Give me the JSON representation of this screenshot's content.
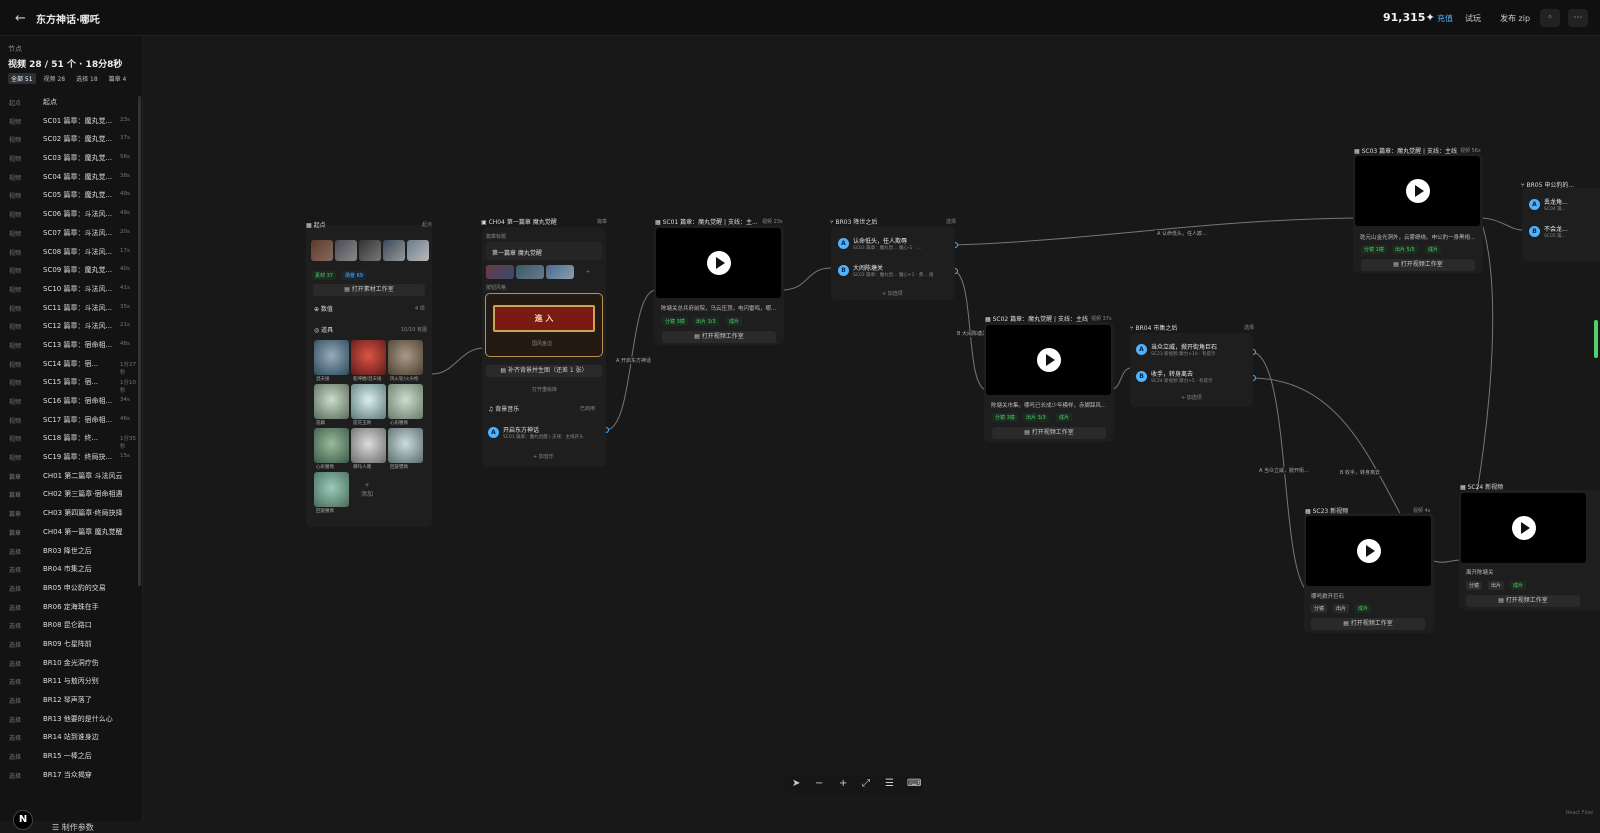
{
  "header": {
    "back_icon": "←",
    "title": "东方神话·哪吒",
    "credits": "91,315✦",
    "recharge": "充值",
    "trial": "试玩",
    "publish": "发布 zip",
    "btn1": "◦",
    "btn2": "⋯"
  },
  "sidebar": {
    "label": "节点",
    "count": "视频 28 / 51 个 · 18分8秒",
    "filters": [
      "全部 51",
      "视频 28",
      "选择 18",
      "篇章 4"
    ],
    "items": [
      {
        "type": "起点",
        "name": "起点",
        "dur": ""
      },
      {
        "type": "视频",
        "name": "SC01 篇章：魔丸觉...",
        "dur": "23s"
      },
      {
        "type": "视频",
        "name": "SC02 篇章：魔丸觉...",
        "dur": "37s"
      },
      {
        "type": "视频",
        "name": "SC03 篇章：魔丸觉...",
        "dur": "56s"
      },
      {
        "type": "视频",
        "name": "SC04 篇章：魔丸觉...",
        "dur": "38s"
      },
      {
        "type": "视频",
        "name": "SC05 篇章：魔丸觉...",
        "dur": "49s"
      },
      {
        "type": "视频",
        "name": "SC06 篇章：斗法风...",
        "dur": "49s"
      },
      {
        "type": "视频",
        "name": "SC07 篇章：斗法风...",
        "dur": "20s"
      },
      {
        "type": "视频",
        "name": "SC08 篇章：斗法风...",
        "dur": "17s"
      },
      {
        "type": "视频",
        "name": "SC09 篇章：魔丸觉...",
        "dur": "40s"
      },
      {
        "type": "视频",
        "name": "SC10 篇章：斗法风...",
        "dur": "41s"
      },
      {
        "type": "视频",
        "name": "SC11 篇章：斗法风...",
        "dur": "35s"
      },
      {
        "type": "视频",
        "name": "SC12 篇章：斗法风...",
        "dur": "21s"
      },
      {
        "type": "视频",
        "name": "SC13 篇章：宿命相...",
        "dur": "48s"
      },
      {
        "type": "视频",
        "name": "SC14 篇章：宿...",
        "dur": "1分27秒"
      },
      {
        "type": "视频",
        "name": "SC15 篇章：宿...",
        "dur": "1分10秒"
      },
      {
        "type": "视频",
        "name": "SC16 篇章：宿命相...",
        "dur": "34s"
      },
      {
        "type": "视频",
        "name": "SC17 篇章：宿命相...",
        "dur": "46s"
      },
      {
        "type": "视频",
        "name": "SC18 篇章：终...",
        "dur": "1分35秒"
      },
      {
        "type": "视频",
        "name": "SC19 篇章：终局抉...",
        "dur": "15s"
      },
      {
        "type": "篇章",
        "name": "CH01 第二篇章 斗法风云",
        "dur": ""
      },
      {
        "type": "篇章",
        "name": "CH02 第三篇章·宿命相遇",
        "dur": ""
      },
      {
        "type": "篇章",
        "name": "CH03 第四篇章·终局抉择",
        "dur": ""
      },
      {
        "type": "篇章",
        "name": "CH04 第一篇章 魔丸觉醒",
        "dur": ""
      },
      {
        "type": "选择",
        "name": "BR03 降世之后",
        "dur": ""
      },
      {
        "type": "选择",
        "name": "BR04 市集之后",
        "dur": ""
      },
      {
        "type": "选择",
        "name": "BR05 申公豹的交易",
        "dur": ""
      },
      {
        "type": "选择",
        "name": "BR06 定海珠在手",
        "dur": ""
      },
      {
        "type": "选择",
        "name": "BR08 昆仑路口",
        "dur": ""
      },
      {
        "type": "选择",
        "name": "BR09 七星阵前",
        "dur": ""
      },
      {
        "type": "选择",
        "name": "BR10 金光洞疗伤",
        "dur": ""
      },
      {
        "type": "选择",
        "name": "BR11 与敖丙分别",
        "dur": ""
      },
      {
        "type": "选择",
        "name": "BR12 琴声落了",
        "dur": ""
      },
      {
        "type": "选择",
        "name": "BR13 他要的是什么心",
        "dur": ""
      },
      {
        "type": "选择",
        "name": "BR14 站到谁身边",
        "dur": ""
      },
      {
        "type": "选择",
        "name": "BR15 一棒之后",
        "dur": ""
      },
      {
        "type": "选择",
        "name": "BR17 当众揭穿",
        "dur": ""
      }
    ],
    "avatar": "N",
    "params": "☰  制作参数"
  },
  "start_node": {
    "head": "▦ 起点",
    "meta": "起点",
    "chips": [
      "素材 37",
      "场景 69"
    ],
    "open_btn": "▤ 打开素材工作室",
    "values_label": "⊕ 数值",
    "values_meta": "4 项",
    "props_label": "◎ 道具",
    "props_meta": "10/10 有图",
    "props": [
      "混天绫",
      "乾坤圈/混天绫",
      "风火轮/火尖枪",
      "莲藕",
      "莲花玉佩",
      "心形腰佩",
      "心形腰佩",
      "哪吒人偶",
      "回旋镖佩",
      "回旋腰佩"
    ],
    "add": "+\n添加"
  },
  "ch04_node": {
    "head": "▣ CH04 第一篇章 魔丸觉醒",
    "meta": "篇章",
    "sub_label": "篇章标题",
    "title": "第一篇章 魔丸觉醒",
    "thumb_more": "+",
    "style_label": "按钮风格",
    "enter": "進 入",
    "style_name": "国风金边",
    "gen_btn": "▤ 补齐背景并生图（还差 1 张）",
    "open_btn": "打开重绘库",
    "music_label": "♫ 背景音乐",
    "music_meta": "已启用",
    "track": "开启东方神话",
    "track_sub": "SC01 篇章：魔丸觉醒 | 支线：主线开头",
    "add_music": "+ 加音乐"
  },
  "sc01": {
    "head": "▦ SC01 篇章：魔丸觉醒 | 支线：主...",
    "meta": "视频 23s",
    "desc": "陈塘关总兵府前院，乌云压顶，电闪雷鸣，哪...",
    "tags": [
      "分镜 3镜",
      "出片 3/3",
      "成片"
    ],
    "btn": "▤ 打开视频工作室"
  },
  "br03": {
    "head": "⑂ BR03 降世之后",
    "meta": "选择",
    "options": [
      {
        "letter": "A",
        "title": "认命低头，任人欺辱",
        "sub": "SC03 篇章：魔丸觉... 魔心-1 · ..."
      },
      {
        "letter": "B",
        "title": "大闹陈塘关",
        "sub": "SC02 篇章：魔丸觉... 魔心+1 · 勇... 值"
      }
    ],
    "add": "+ 加选项"
  },
  "sc02": {
    "head": "▦ SC02 篇章：魔丸觉醒 | 支线：主线",
    "meta": "视频 37s",
    "desc": "陈塘关市集。哪吒已长成少年模样，赤脚踩风...",
    "tags": [
      "分镜 3镜",
      "出片 3/3",
      "成片"
    ],
    "btn": "▤ 打开视频工作室"
  },
  "br04": {
    "head": "⑂ BR04 市集之后",
    "meta": "选择",
    "options": [
      {
        "letter": "A",
        "title": "当众立威，掀开街角巨石",
        "sub": "SC23 新视频  摩力+10 · 有提示"
      },
      {
        "letter": "B",
        "title": "收手，转身离去",
        "sub": "SC24 新视频  摩力+5 · 有提示"
      }
    ],
    "add": "+ 加选项"
  },
  "sc03": {
    "head": "▦ SC03 篇章：魔丸觉醒 | 支线：主线",
    "meta": "视频 56s",
    "desc": "乾元山金光洞外，云雾缭绕。申公豹一身黑袍...",
    "tags": [
      "分镜 1镜",
      "出片 5/5",
      "成片"
    ],
    "btn": "▤ 打开视频工作室"
  },
  "br05": {
    "head": "⑂ BR05 申公豹的...",
    "options": [
      {
        "letter": "A",
        "title": "丢龙角...",
        "sub": "SC04 篇..."
      },
      {
        "letter": "B",
        "title": "不会龙...",
        "sub": "SC05 篇..."
      }
    ]
  },
  "sc23": {
    "head": "▦ SC23 新视频",
    "meta": "视频 4s",
    "desc": "哪吒掀开巨石",
    "tags": [
      "分镜",
      "出片",
      "成片"
    ],
    "btn": "▤ 打开视频工作室"
  },
  "sc24": {
    "head": "▦ SC24 新视频",
    "desc": "离开陈塘关",
    "tags": [
      "分镜",
      "出片",
      "成片"
    ],
    "btn": "▤ 打开视频工作室"
  },
  "edge_labels": {
    "e1": "A 开启东方神话",
    "e2": "A 认命低头，任人欺...",
    "e3": "B 大闹陈塘关",
    "e4": "A 当众立威，掀开街...",
    "e5": "B 收手，转身离去"
  },
  "toolbar": {
    "pointer": "➤",
    "zoom_out": "−",
    "zoom_in": "+",
    "fit": "⤢",
    "layout": "☰",
    "keyboard": "⌨"
  },
  "attribution": "React Flow",
  "colors": {
    "accent": "#4fb3ff",
    "success": "#4fd26b",
    "gold": "#c9a35a",
    "enter_red": "#7a1a14"
  }
}
